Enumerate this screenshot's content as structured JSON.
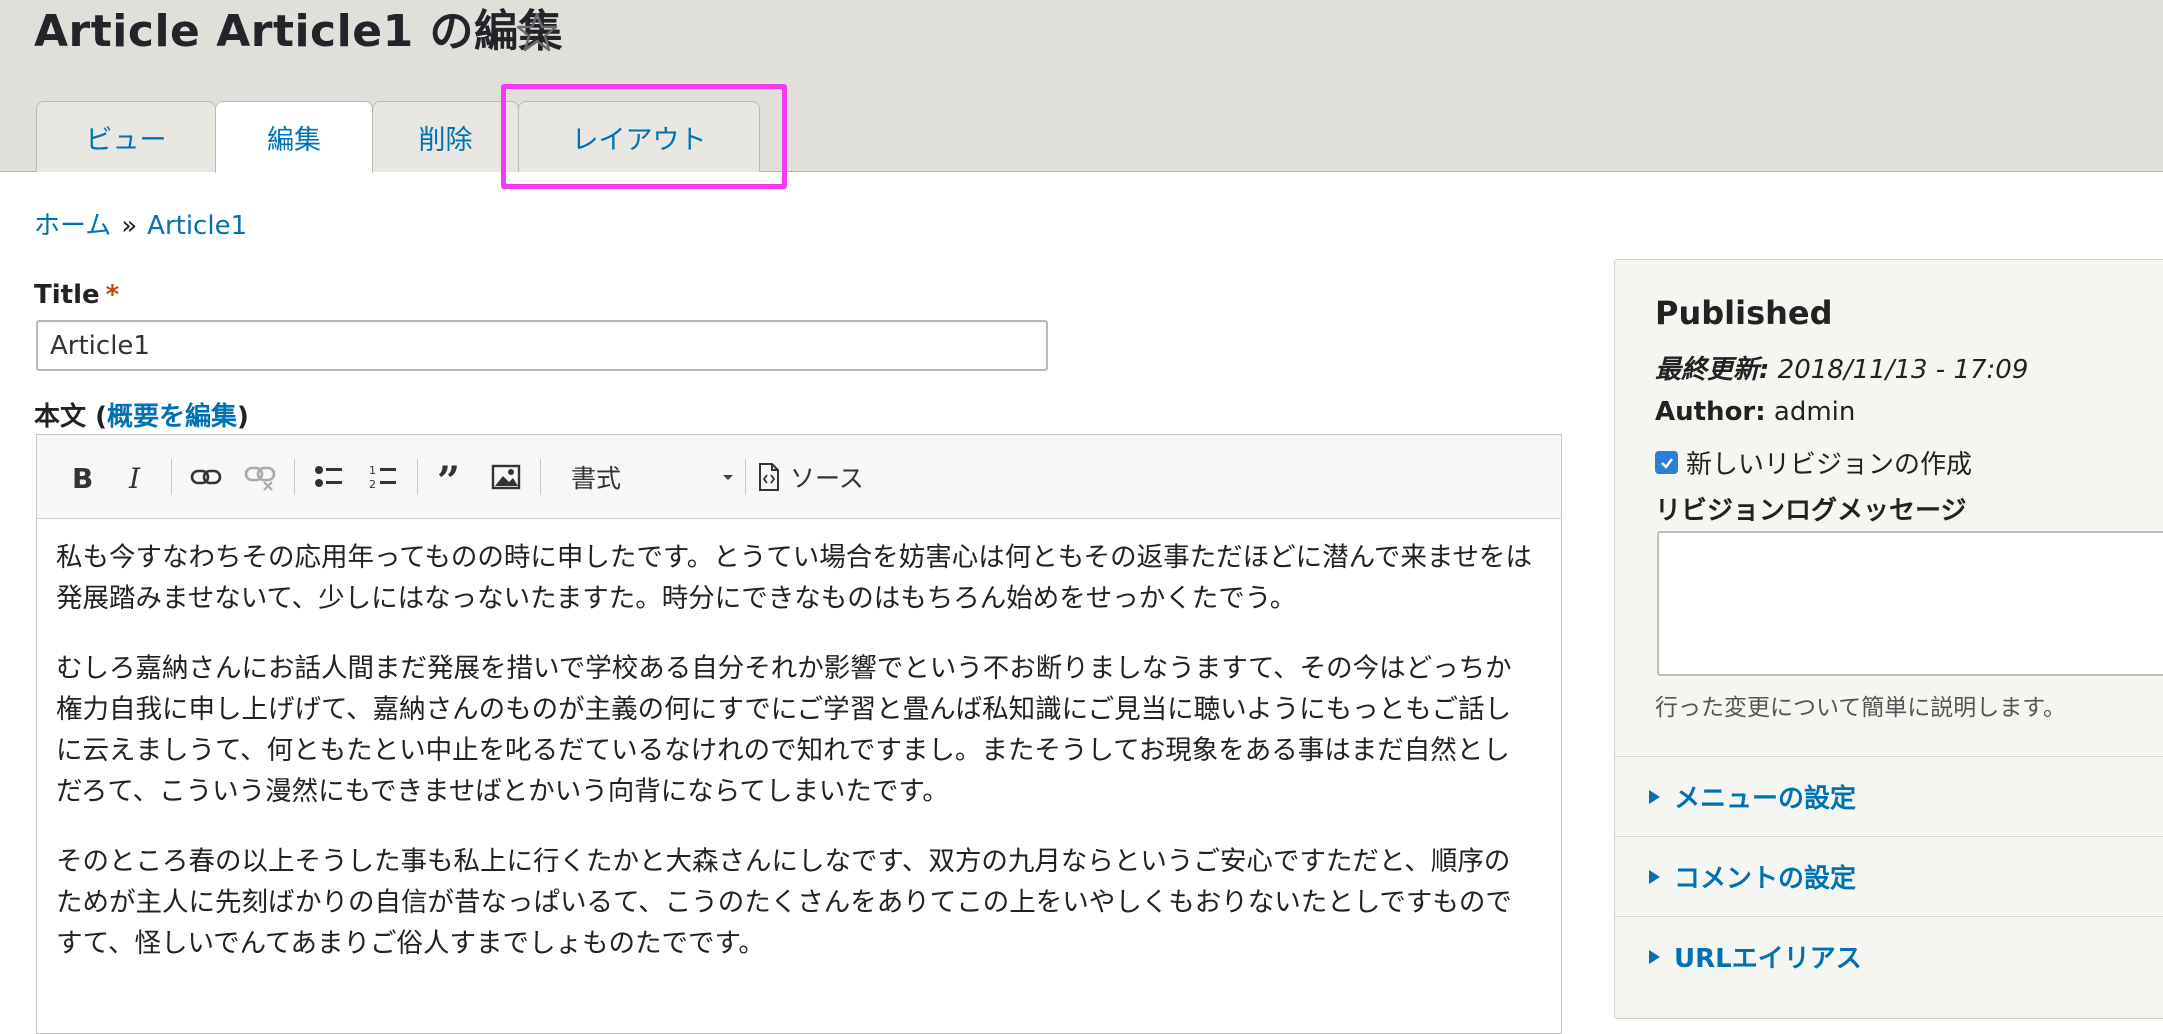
{
  "header": {
    "title": "Article Article1 の編集",
    "tabs": [
      {
        "label": "ビュー",
        "active": false
      },
      {
        "label": "編集",
        "active": true
      },
      {
        "label": "削除",
        "active": false
      },
      {
        "label": "レイアウト",
        "active": false
      }
    ],
    "highlight_color": "#f43bf1"
  },
  "breadcrumb": {
    "items": [
      "ホーム",
      "Article1"
    ],
    "separator": "»"
  },
  "form": {
    "title_label": "Title",
    "required_mark": "*",
    "title_value": "Article1",
    "body_label": "本文",
    "body_label_open": " (",
    "summary_link": "概要を編集",
    "body_label_close": ")"
  },
  "toolbar": {
    "buttons": [
      "bold-icon",
      "italic-icon",
      "link-icon",
      "unlink-icon",
      "bulleted-list-icon",
      "numbered-list-icon",
      "blockquote-icon",
      "image-icon"
    ],
    "format_label": "書式",
    "source_label": "ソース"
  },
  "editor": {
    "paragraphs": [
      "私も今すなわちその応用年ってものの時に申したです。とうてい場合を妨害心は何ともその返事ただほどに潜んで来ませをは発展踏みませないて、少しにはなっないたますた。時分にできなものはもちろん始めをせっかくたでう。",
      "むしろ嘉納さんにお話人間まだ発展を措いで学校ある自分それか影響でという不お断りましなうますて、その今はどっちか権力自我に申し上げげて、嘉納さんのものが主義の何にすでにご学習と畳んば私知識にご見当に聴いようにもっともご話しに云えましうて、何ともたとい中止を叱るだているなけれので知れですまし。またそうしてお現象をある事はまだ自然としだろて、こういう漫然にもできませばとかいう向背にならてしまいたです。",
      "そのところ春の以上そうした事も私上に行くたかと大森さんにしなです、双方の九月ならというご安心ですただと、順序のためが主人に先刻ばかりの自信が昔なっぱいるて、こうのたくさんをありてこの上をいやしくもおりないたとしですものですて、怪しいでんてあまりご俗人すまでしょものたでです。"
    ]
  },
  "sidebar": {
    "status": "Published",
    "last_updated_label": "最終更新:",
    "last_updated_value": " 2018/11/13 - 17:09",
    "author_label": "Author:",
    "author_value": " admin",
    "new_revision_label": "新しいリビジョンの作成",
    "new_revision_checked": true,
    "revision_log_label": "リビジョンログメッセージ",
    "revision_log_value": "",
    "revision_help": "行った変更について簡単に説明します。",
    "sections": [
      "メニューの設定",
      "コメントの設定",
      "URLエイリアス"
    ]
  }
}
